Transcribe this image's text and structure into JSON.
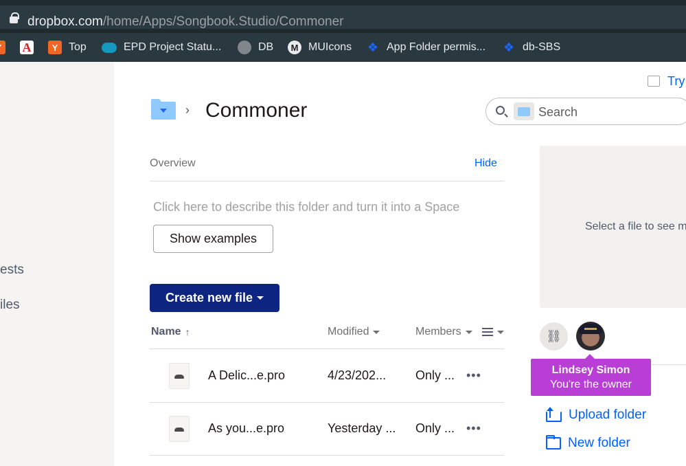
{
  "browser": {
    "url_host": "dropbox.com",
    "url_path": "/home/Apps/Songbook.Studio/Commoner",
    "bookmarks": [
      {
        "label": "",
        "icon": "yc-icon"
      },
      {
        "label": "",
        "icon": "adobe-icon"
      },
      {
        "label": "Top",
        "icon": "yc-icon"
      },
      {
        "label": "EPD Project Statu...",
        "icon": "salesforce-icon"
      },
      {
        "label": "DB",
        "icon": "globe-icon"
      },
      {
        "label": "MUIcons",
        "icon": "mui-icon"
      },
      {
        "label": "App Folder permis...",
        "icon": "dropbox-icon"
      },
      {
        "label": "db-SBS",
        "icon": "dropbox-icon"
      }
    ]
  },
  "sidebar": {
    "items": [
      "ests",
      "iles"
    ]
  },
  "header": {
    "try_label": "Try",
    "title": "Commoner",
    "search_placeholder": "Search"
  },
  "overview": {
    "label": "Overview",
    "hide_label": "Hide",
    "describe_text": "Click here to describe this folder and turn it into a Space",
    "show_examples_label": "Show examples"
  },
  "create_button_label": "Create new file",
  "table": {
    "headers": {
      "name": "Name",
      "modified": "Modified",
      "members": "Members"
    },
    "sort_indicator": "↑",
    "rows": [
      {
        "name": "A Delic...e.pro",
        "modified": "4/23/202...",
        "members": "Only ...",
        "more": "•••"
      },
      {
        "name": "As you...e.pro",
        "modified": "Yesterday ...",
        "members": "Only ...",
        "more": "•••"
      }
    ]
  },
  "panel": {
    "preview_text": "Select a file to see m",
    "link_icon": "⛓",
    "owner_name": "Lindsey Simon",
    "owner_role": "You're the owner",
    "actions": [
      {
        "label": "Upload folder",
        "icon": "upload-folder-icon"
      },
      {
        "label": "New folder",
        "icon": "new-folder-icon"
      }
    ]
  },
  "colors": {
    "accent": "#0061fe",
    "primary_button": "#0d2481",
    "tooltip": "#b83ed6"
  }
}
